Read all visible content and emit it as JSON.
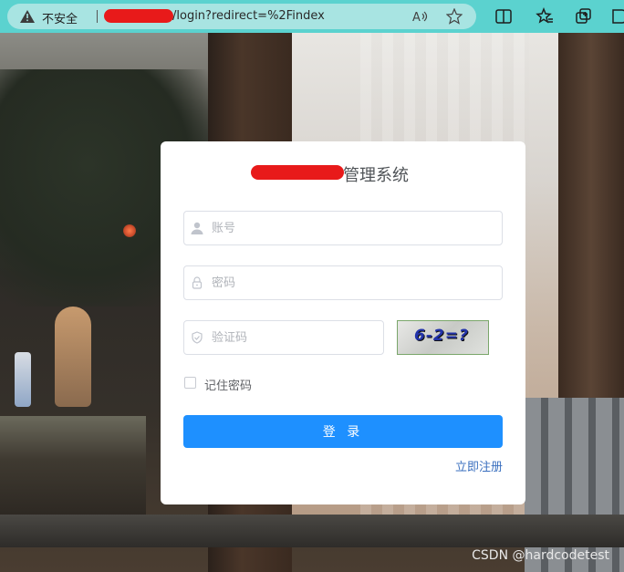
{
  "browser": {
    "security_label": "不安全",
    "url_suffix": "/login?redirect=%2Findex"
  },
  "login": {
    "title_suffix": "管理系统",
    "username_placeholder": "账号",
    "password_placeholder": "密码",
    "captcha_placeholder": "验证码",
    "captcha_text": "6-2=?",
    "remember_label": "记住密码",
    "login_button": "登 录",
    "register_link": "立即注册"
  },
  "watermark": "CSDN @hardcodetest",
  "colors": {
    "primary": "#1e90ff",
    "browser_bar": "#5bd2cf",
    "redaction": "#e81a1a"
  },
  "icons": [
    "warning-icon",
    "read-aloud-icon",
    "favorite-icon",
    "split-screen-icon",
    "favorites-icon",
    "collections-icon",
    "browser-essentials-icon",
    "user-icon",
    "lock-icon",
    "shield-icon"
  ]
}
